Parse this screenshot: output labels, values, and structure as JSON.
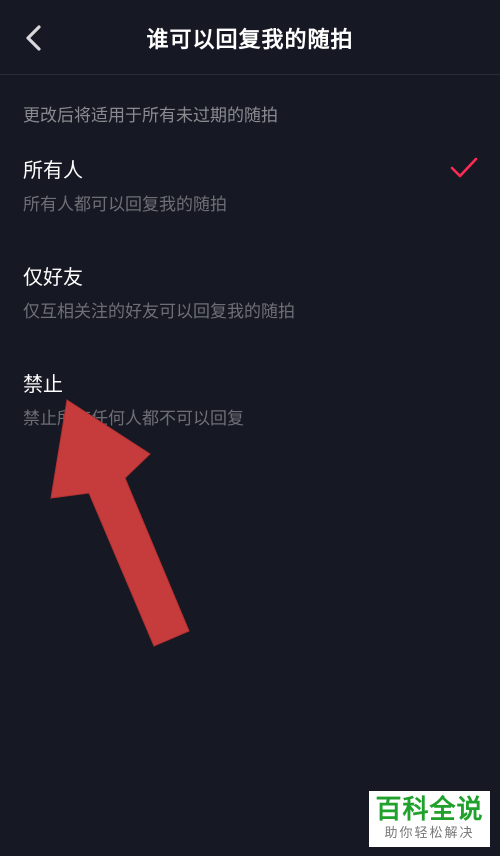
{
  "header": {
    "title": "谁可以回复我的随拍",
    "back_icon": "chevron-left-icon"
  },
  "notice": "更改后将适用于所有未过期的随拍",
  "options": [
    {
      "title": "所有人",
      "description": "所有人都可以回复我的随拍",
      "selected": true
    },
    {
      "title": "仅好友",
      "description": "仅互相关注的好友可以回复我的随拍",
      "selected": false
    },
    {
      "title": "禁止",
      "description": "禁止所有任何人都不可以回复",
      "selected": false
    }
  ],
  "colors": {
    "background": "#161823",
    "accent": "#fe2c55",
    "annotation_arrow": "#c63c3c",
    "watermark_green": "#1fa12b"
  },
  "watermark": {
    "main": "百科全说",
    "sub": "助你轻松解决"
  }
}
